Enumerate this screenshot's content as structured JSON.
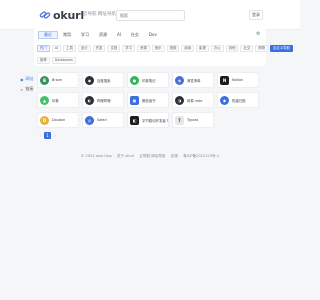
{
  "header": {
    "logo_text": "okurl",
    "logo_sub": "云导航·网址导航",
    "search_placeholder": "搜索",
    "right_button": "登录"
  },
  "sidebar": {
    "items": [
      {
        "label": "网址",
        "active": true
      },
      {
        "label": "链接",
        "active": false
      }
    ]
  },
  "categories": {
    "tabs": [
      "最近",
      "常用",
      "学习",
      "资源",
      "AI",
      "社交",
      "Dev"
    ],
    "selected_index": 0
  },
  "tags": {
    "row1": [
      "热门",
      "AI",
      "工具",
      "设计",
      "开发",
      "文档",
      "学习",
      "资源",
      "音乐",
      "视频",
      "阅读",
      "影视",
      "办公",
      "其他",
      "社交",
      "购物",
      "新闻",
      "游戏",
      "自定义导航"
    ],
    "row2": [
      "推荐",
      "Databases"
    ]
  },
  "cards": [
    {
      "label": "Brave",
      "icon": "B",
      "color": "#3a8f5a",
      "shape": "circle"
    },
    {
      "label": "百度搜索",
      "icon": "◉",
      "color": "#2b2f36",
      "shape": "circle"
    },
    {
      "label": "印象笔记",
      "icon": "●",
      "color": "#2fb45a",
      "shape": "circle"
    },
    {
      "label": "滴答清单",
      "icon": "◈",
      "color": "#4b6fd6",
      "shape": "circle"
    },
    {
      "label": "Notion",
      "icon": "N",
      "color": "#1c1c1c",
      "shape": "square"
    },
    {
      "label": "印象",
      "icon": "▲",
      "color": "#3ec16a",
      "shape": "circle"
    },
    {
      "label": "哔哩哔哩",
      "icon": "◐",
      "color": "#2b2f36",
      "shape": "circle"
    },
    {
      "label": "微信读书",
      "icon": "▣",
      "color": "#3b6fe0",
      "shape": "square"
    },
    {
      "label": "网易 note",
      "icon": "◑",
      "color": "#2b2f36",
      "shape": "circle"
    },
    {
      "label": "知道日报",
      "icon": "◆",
      "color": "#3b6fe0",
      "shape": "circle"
    },
    {
      "label": "Douban",
      "icon": "D",
      "color": "#e2b33c",
      "shape": "circle"
    },
    {
      "label": "Safari",
      "icon": "◎",
      "color": "#3b6fe0",
      "shape": "circle"
    },
    {
      "label": "字节跳动开发者 Trae",
      "icon": "◧",
      "color": "#1c1c1c",
      "shape": "square"
    },
    {
      "label": "Typora",
      "icon": "T",
      "color": "#e6e6e6",
      "shape": "square"
    }
  ],
  "pager": {
    "prev": "‹",
    "page": "1",
    "next": "›"
  },
  "footer": {
    "items": [
      "© 2024 okurl.top",
      "关于 okurl",
      "云导航·网址导航",
      "反馈",
      "粤ICP备2022123号-1"
    ]
  }
}
